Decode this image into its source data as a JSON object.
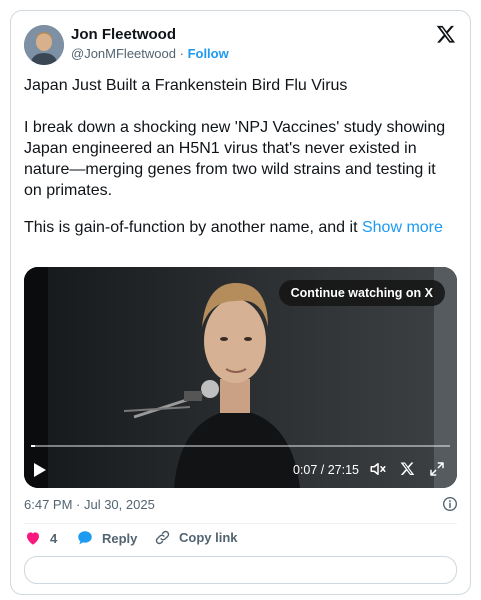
{
  "author": {
    "name": "Jon Fleetwood",
    "handle": "@JonMFleetwood",
    "separator": "·",
    "follow_label": "Follow"
  },
  "post": {
    "title": "Japan Just Built a Frankenstein Bird Flu Virus",
    "paragraph": "I break down a shocking new 'NPJ Vaccines' study showing Japan engineered an H5N1 virus that's never existed in nature—merging genes from two wild strains and testing it on primates.",
    "truncated": "This is gain-of-function by another name, and it",
    "show_more": "Show more"
  },
  "video": {
    "continue_label": "Continue watching on X",
    "time": "0:07 / 27:15",
    "progress": 0.004
  },
  "timestamp": "6:47 PM · Jul 30, 2025",
  "actions": {
    "likes": "4",
    "reply": "Reply",
    "copy_link": "Copy link"
  },
  "colors": {
    "accent": "#1d9bf0",
    "like": "#f91880",
    "text": "#0f1419",
    "muted": "#536471"
  }
}
